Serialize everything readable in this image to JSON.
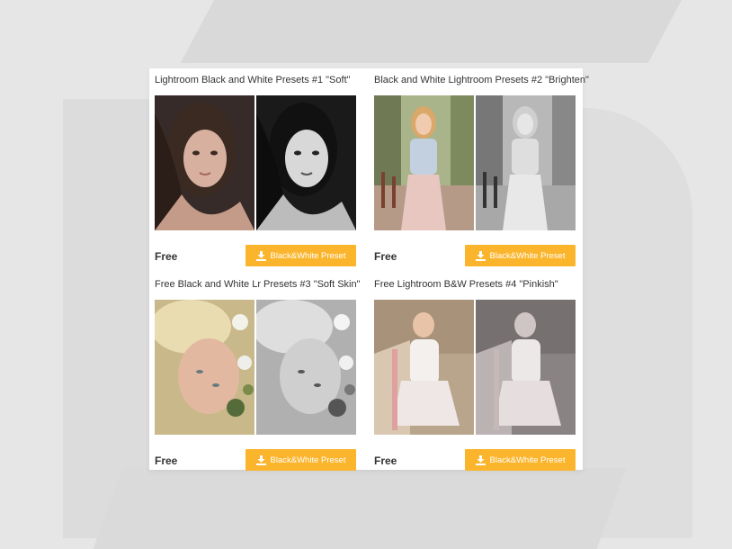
{
  "theme": {
    "accent": "#fbb52c",
    "card_bg": "#ffffff",
    "page_bg": "#e6e6e6"
  },
  "presets": [
    {
      "title": "Lightroom Black and White Presets #1 \"Soft\"",
      "price": "Free",
      "button_label": "Black&White Preset",
      "icon": "download-icon"
    },
    {
      "title": "Black and White Lightroom Presets #2 \"Brighten\"",
      "price": "Free",
      "button_label": "Black&White Preset",
      "icon": "download-icon"
    },
    {
      "title": "Free Black and White Lr Presets #3 \"Soft Skin\"",
      "price": "Free",
      "button_label": "Black&White Preset",
      "icon": "download-icon"
    },
    {
      "title": "Free Lightroom B&W Presets #4 \"Pinkish\"",
      "price": "Free",
      "button_label": "Black&White Preset",
      "icon": "download-icon"
    }
  ]
}
